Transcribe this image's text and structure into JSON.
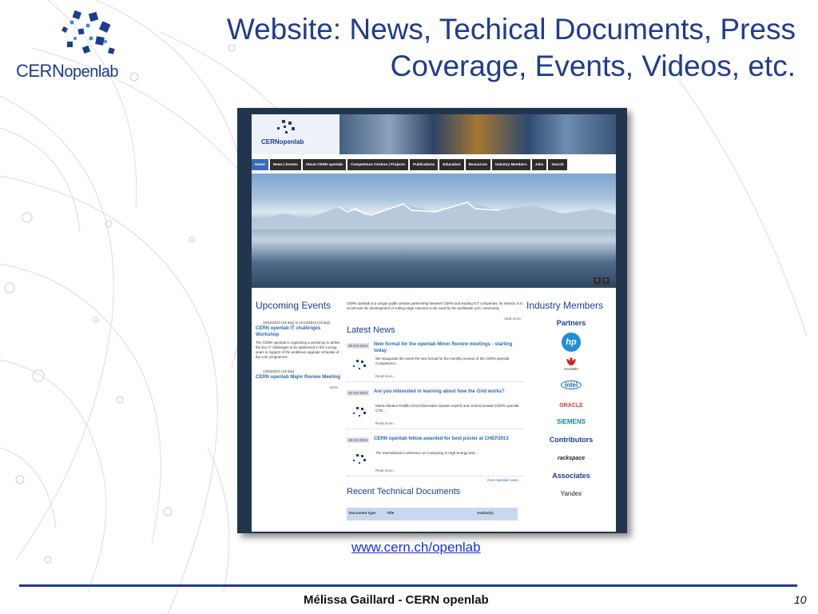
{
  "slide": {
    "title_line1": "Website: News, Techical Documents, Press",
    "title_line2": "Coverage, Events, Videos, etc.",
    "logo_cern": "CERN",
    "logo_openlab": "openlab",
    "url": "www.cern.ch/openlab",
    "footer_author": "Mélissa Gaillard - CERN openlab",
    "page_number": "10"
  },
  "website": {
    "logo_text": "CERNopenlab",
    "nav": [
      "Home",
      "News | Events",
      "About CERN openlab",
      "Competence Centres | Projects",
      "Publications",
      "Education",
      "Resources",
      "Industry Members",
      "Jobs",
      "Search"
    ],
    "upcoming_heading": "Upcoming Events",
    "events": [
      {
        "date": "10/12/2013 (All day) to 11/12/2013 (All day)",
        "title": "CERN openlab IT challenges Workshop",
        "desc": "The CERN openlab is organizing a workshop to define the key IT challenges to be addressed in the coming years in support of the ambitious upgrade schedule of the LHC programme."
      },
      {
        "date": "13/02/2014 (All day)",
        "title": "CERN openlab Major Review Meeting"
      }
    ],
    "more_events": "more",
    "intro": "CERN openlab is a unique public-private partnership between CERN and leading ICT companies. Its mission is to accelerate the development of cutting-edge solutions to be used by the worldwide LHC community",
    "read_more": "read more",
    "news_heading": "Latest News",
    "news": [
      {
        "date": "29 Oct 2013",
        "title": "New format for the openlab Minor Review meetings - starting today",
        "desc": "We inaugurate this week the new format for the monthly reviews of the CERN openlab Competence...",
        "more": "Read more..."
      },
      {
        "date": "22 Oct 2013",
        "title": "Are you interested in learning about how the Grid works?",
        "desc": "Maria Alandes Pradillo (Grid Information System expert) and Andrzej Nowak (CERN openlab CTO...",
        "more": "Read more..."
      },
      {
        "date": "18 Oct 2013",
        "title": "CERN openlab fellow awarded for best poster at CHEP2013",
        "desc": "The International Conference on Computing in High Energy and...",
        "more": "Read more..."
      }
    ],
    "more_news": "more openlab news...",
    "docs_heading": "Recent Technical Documents",
    "doc_columns": [
      "Document type",
      "Title",
      "Author(s)"
    ],
    "industry_heading": "Industry Members",
    "partners_label": "Partners",
    "partners": [
      "hp",
      "HUAWEI",
      "intel",
      "ORACLE",
      "SIEMENS"
    ],
    "contributors_label": "Contributors",
    "contributors": [
      "rackspace"
    ],
    "associates_label": "Associates",
    "associates": [
      "Yandex"
    ]
  },
  "colors": {
    "title": "#1f3c8f",
    "link": "#2a6ab3",
    "nav_bg": "#2d2d2d",
    "url": "#1a2fd6"
  }
}
